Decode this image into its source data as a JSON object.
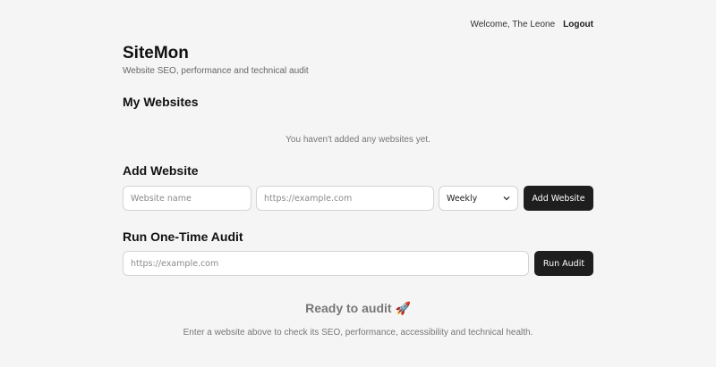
{
  "header": {
    "welcome": "Welcome, The Leone",
    "logout": "Logout"
  },
  "app": {
    "title": "SiteMon",
    "subtitle": "Website SEO, performance and technical audit"
  },
  "websites": {
    "title": "My Websites",
    "empty": "You haven't added any websites yet."
  },
  "add": {
    "title": "Add Website",
    "name_placeholder": "Website name",
    "url_placeholder": "https://example.com",
    "frequency": "Weekly",
    "button": "Add Website"
  },
  "audit": {
    "title": "Run One-Time Audit",
    "url_placeholder": "https://example.com",
    "button": "Run Audit"
  },
  "ready": {
    "title": "Ready to audit 🚀",
    "description": "Enter a website above to check its SEO, performance, accessibility and technical health."
  }
}
